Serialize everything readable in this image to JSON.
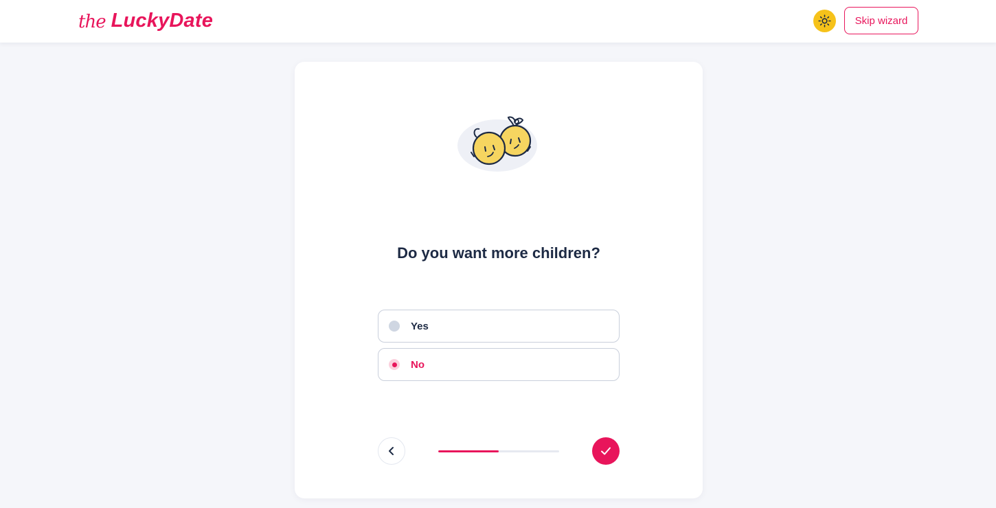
{
  "header": {
    "logo_prefix": "the",
    "logo_name": "LuckyDate",
    "theme_toggle_icon": "sun-icon",
    "skip_label": "Skip wizard"
  },
  "wizard": {
    "illustration": "two-babies-illustration",
    "question": "Do you want more children?",
    "options": [
      {
        "label": "Yes",
        "selected": false
      },
      {
        "label": "No",
        "selected": true
      }
    ],
    "back_icon": "chevron-left-icon",
    "next_icon": "check-icon",
    "progress_fraction": 0.5
  },
  "colors": {
    "brand": "#e8155b",
    "theme_toggle": "#f6c21a",
    "text_primary": "#1d2a44",
    "background": "#f5f6fa"
  }
}
